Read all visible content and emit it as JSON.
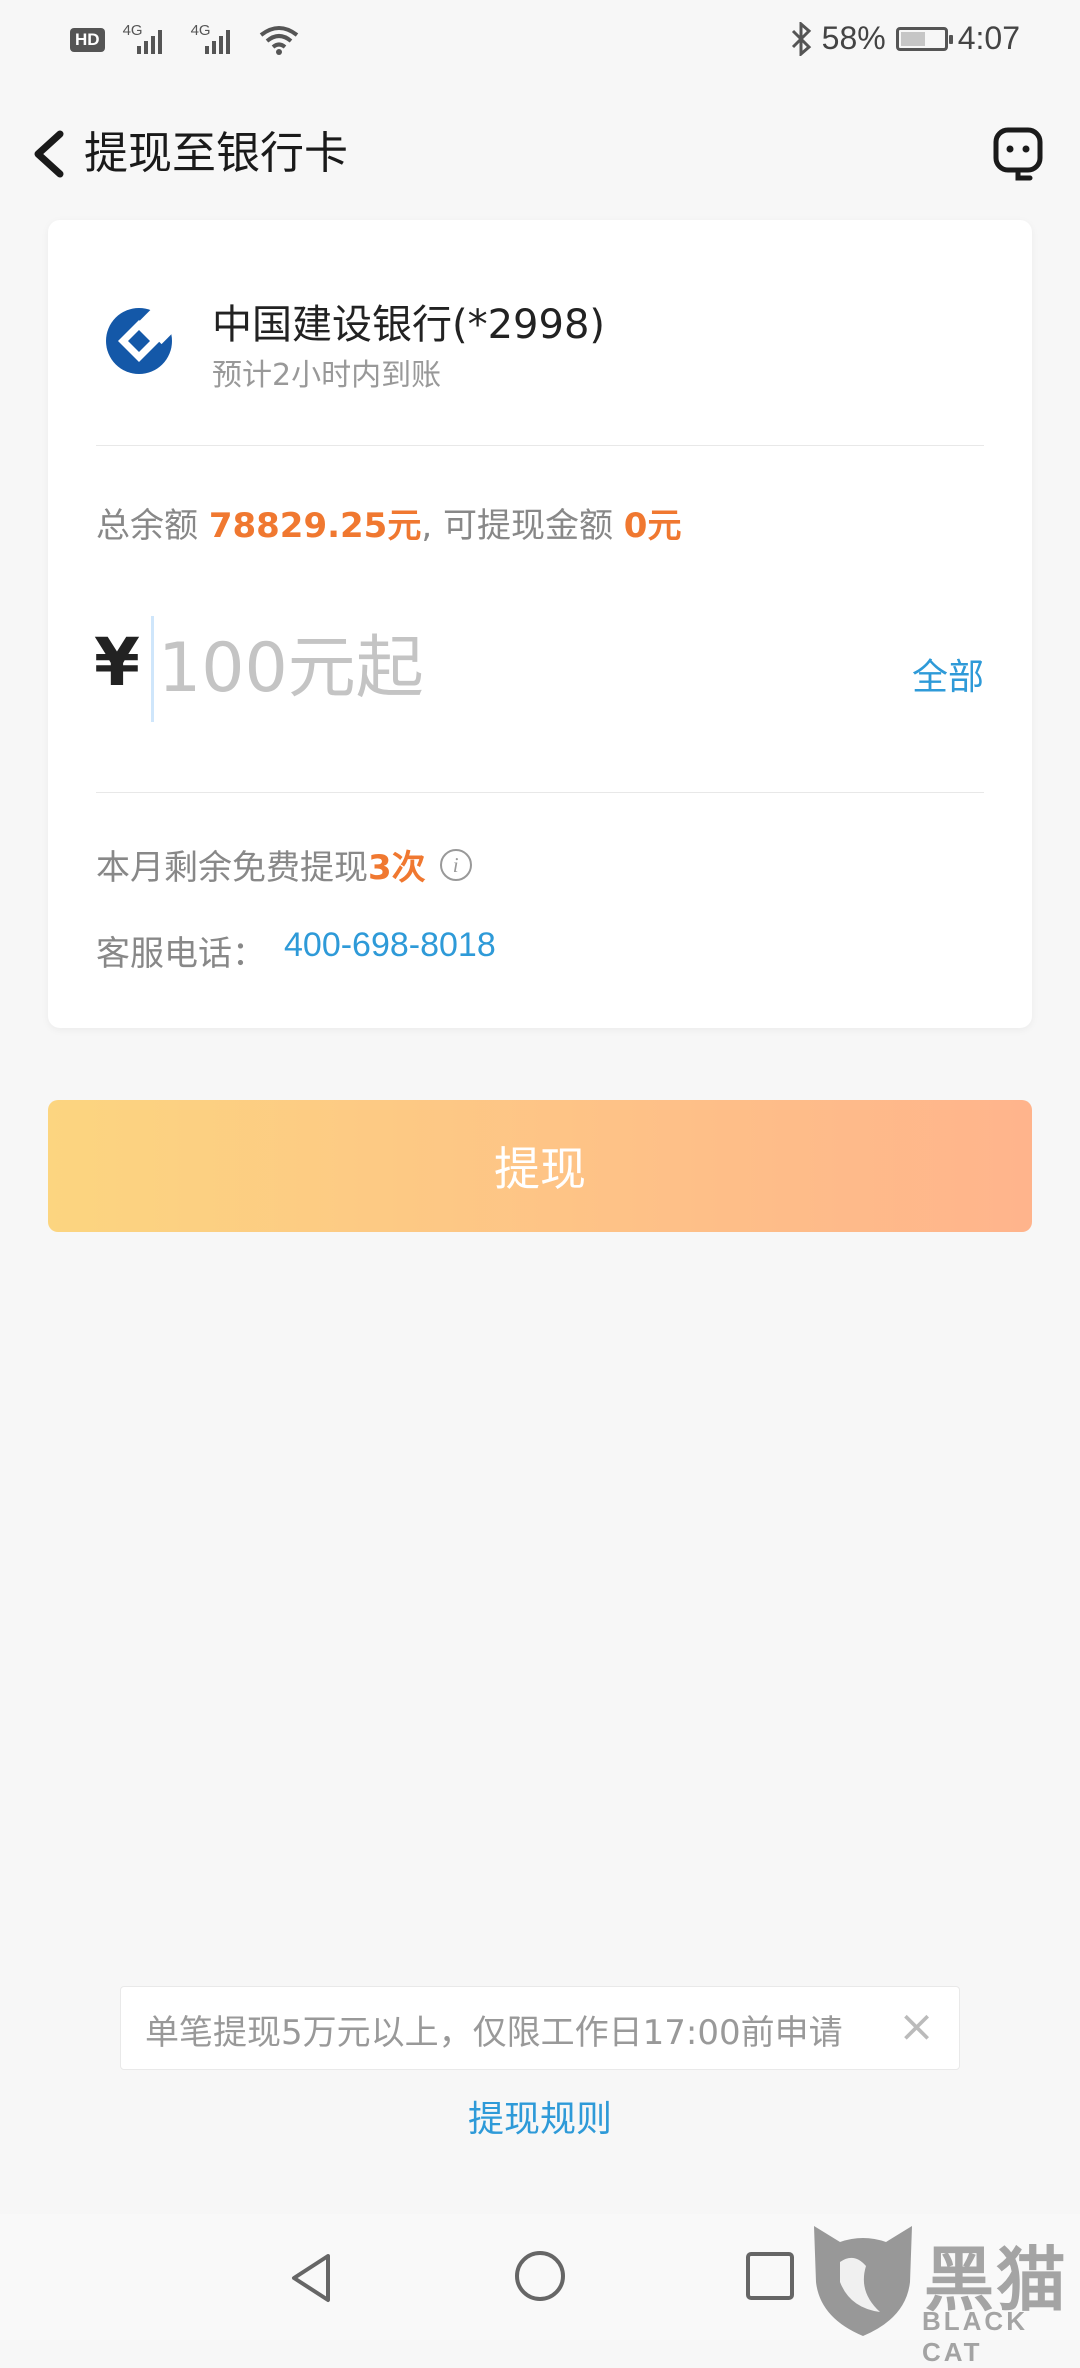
{
  "status_bar": {
    "hd": "HD",
    "network1": "4G",
    "network2": "4G",
    "battery_percent": "58%",
    "battery_level": 0.58,
    "time": "4:07"
  },
  "header": {
    "title": "提现至银行卡"
  },
  "bank": {
    "name": "中国建设银行(*2998)",
    "arrival": "预计2小时内到账",
    "logo_color": "#1458a8"
  },
  "balance": {
    "total_label": "总余额",
    "total_value": "78829.25元",
    "separator": ",",
    "available_label": "可提现金额",
    "available_value": "0元"
  },
  "amount": {
    "currency": "¥",
    "placeholder": "100元起",
    "value": "",
    "all_label": "全部"
  },
  "free_withdraw": {
    "label": "本月剩余免费提现",
    "count": "3次"
  },
  "service": {
    "label": "客服电话：",
    "phone": "400-698-8018"
  },
  "withdraw_button": "提现",
  "notice": {
    "text": "单笔提现5万元以上，仅限工作日17:00前申请",
    "close": "×"
  },
  "rules_link": "提现规则",
  "watermark": {
    "title": "黑猫",
    "subtitle": "BLACK CAT"
  },
  "colors": {
    "accent_orange": "#f07830",
    "link_blue": "#2e9ad8",
    "button_gradient_start": "#fcd580",
    "button_gradient_end": "#ffb48c"
  }
}
